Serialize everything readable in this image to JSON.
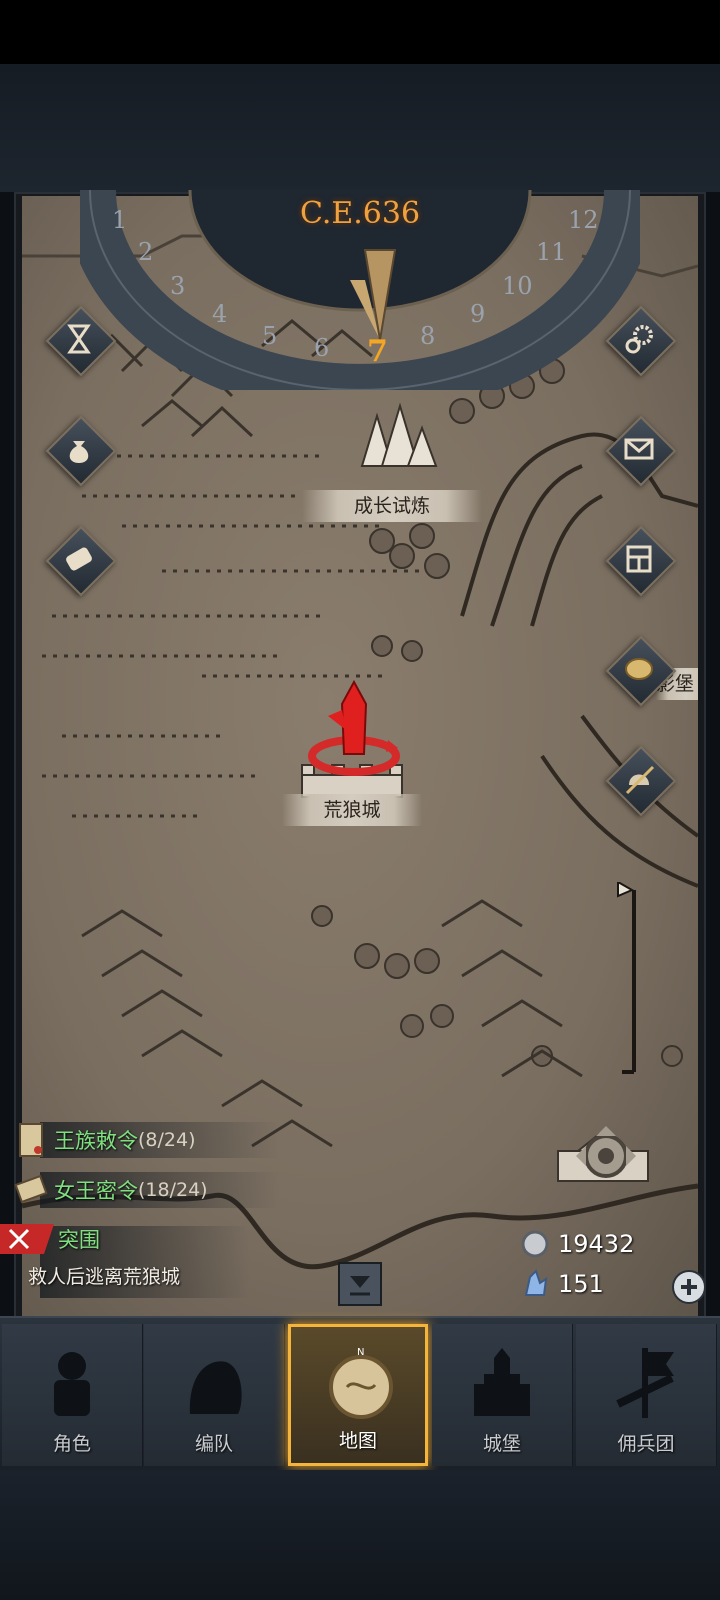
{
  "calendar": {
    "year": "C.E.636",
    "months": [
      "1",
      "2",
      "3",
      "4",
      "5",
      "6",
      "7",
      "8",
      "9",
      "10",
      "11",
      "12"
    ],
    "current_month": "7"
  },
  "map": {
    "locations": [
      {
        "name": "成长试炼"
      },
      {
        "name": "荒狼城"
      },
      {
        "name": "影堡"
      }
    ]
  },
  "quests": {
    "royal_edict": {
      "label": "王族敕令",
      "count": "(8/24)"
    },
    "queen_secret": {
      "label": "女王密令",
      "count": "(18/24)"
    },
    "breakout": {
      "title": "突围",
      "desc": "救人后逃离荒狼城"
    }
  },
  "resources": {
    "silver": "19432",
    "crystal": "151"
  },
  "left_buttons": [
    {
      "icon": "hourglass-icon"
    },
    {
      "icon": "bag-icon"
    },
    {
      "icon": "scroll-icon"
    }
  ],
  "right_buttons": [
    {
      "icon": "gear-icon"
    },
    {
      "icon": "mail-icon"
    },
    {
      "icon": "board-icon"
    },
    {
      "icon": "coin-icon"
    },
    {
      "icon": "helmet-sword-icon"
    }
  ],
  "nav": {
    "tabs": [
      {
        "label": "角色"
      },
      {
        "label": "编队"
      },
      {
        "label": "地图"
      },
      {
        "label": "城堡"
      },
      {
        "label": "佣兵团"
      }
    ],
    "active": "地图"
  },
  "colors": {
    "accent": "#f5a623",
    "quest_green": "#7fe07f",
    "alert_red": "#d42a2a"
  }
}
